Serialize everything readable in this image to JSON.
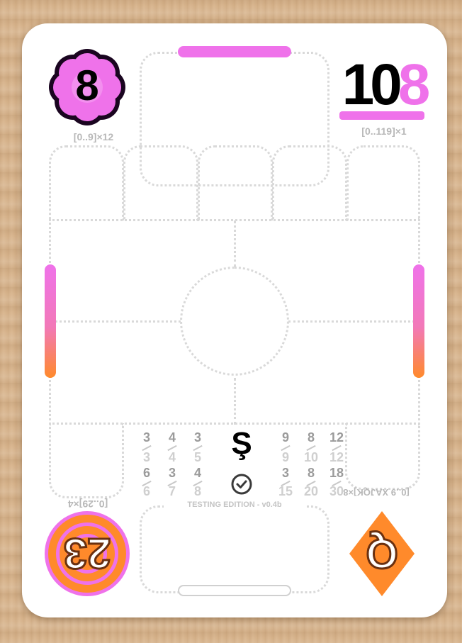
{
  "card": {
    "top_left_rank": "8",
    "top_left_range": "[0..9]×12",
    "top_right_number_main": "10",
    "top_right_number_accent": "8",
    "top_right_range": "[0..119]×1",
    "bottom_left_number": "23",
    "bottom_left_range": "[0..29]×4",
    "bottom_right_rank": "Q",
    "bottom_right_range": "[0..9 XAJQK]×8",
    "center_symbol": "Ş",
    "edition": "TESTING EDITION - v0.4b"
  },
  "number_grid": [
    {
      "top": "3",
      "bottom": "3",
      "top2": "6",
      "bottom2": "6"
    },
    {
      "top": "4",
      "bottom": "4",
      "top2": "3",
      "bottom2": "7"
    },
    {
      "top": "3",
      "bottom": "5",
      "top2": "4",
      "bottom2": "8"
    },
    {
      "top": "9",
      "bottom": "9",
      "top2": "3",
      "bottom2": "15"
    },
    {
      "top": "8",
      "bottom": "10",
      "top2": "8",
      "bottom2": "20"
    },
    {
      "top": "12",
      "bottom": "12",
      "top2": "18",
      "bottom2": "30"
    }
  ],
  "colors": {
    "pink": "#ef72ea",
    "orange": "#ff8a2b",
    "dark": "#1a0520",
    "zone_border": "#d9d9d9"
  },
  "icons": {
    "center_badge": "check-circle-icon"
  }
}
